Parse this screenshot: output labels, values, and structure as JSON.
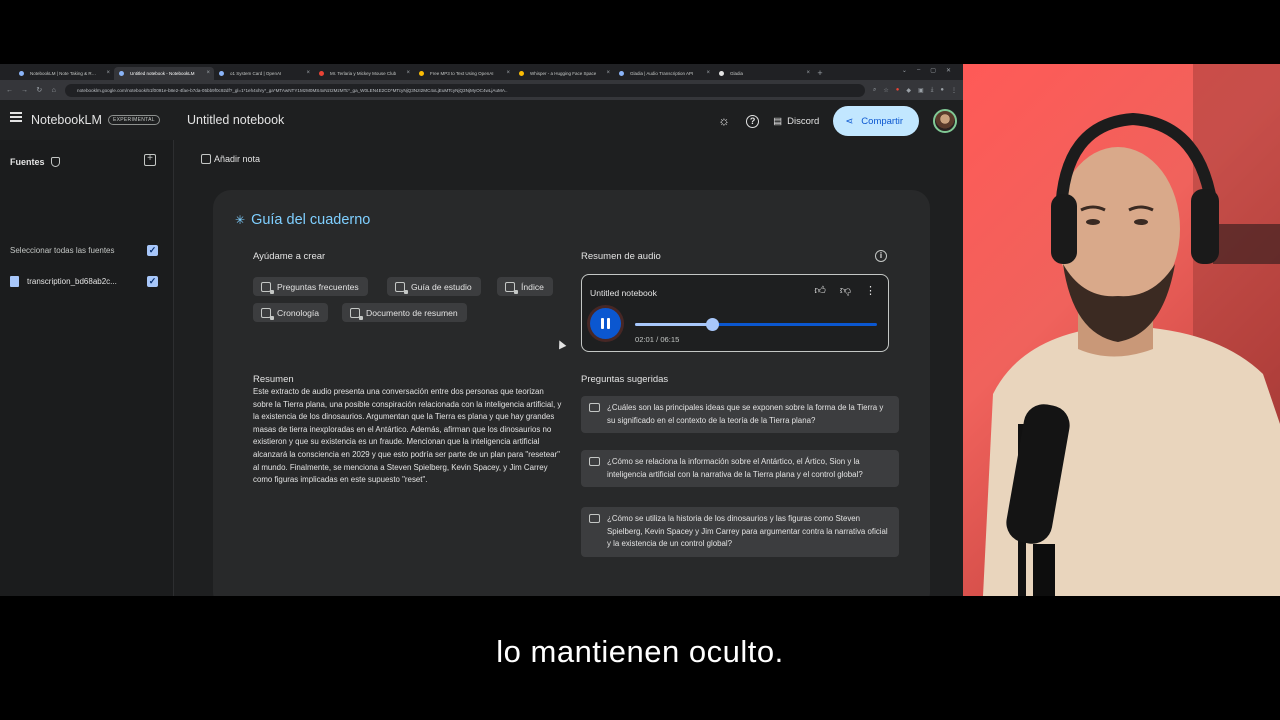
{
  "browser": {
    "tabs": [
      {
        "label": "NotebookLM | Note Taking & Research",
        "active": false
      },
      {
        "label": "Untitled notebook - NotebookLM",
        "active": true
      },
      {
        "label": "o1 System Card | OpenAI",
        "active": false
      },
      {
        "label": "Mr. Terlaria y Mickey Mouse Club",
        "active": false
      },
      {
        "label": "Free MP3 to Text Using OpenAI",
        "active": false
      },
      {
        "label": "Whisper - a Hugging Face Space",
        "active": false
      },
      {
        "label": "Gladia | Audio Transcription API",
        "active": false
      },
      {
        "label": "Gladia",
        "active": false
      }
    ],
    "new_tab": "+",
    "url": "notebooklm.google.com/notebook/51f0091e-b8e2-4fae-b7da-05bb9f0c92df?_gl=1*1eh4xhry*_ga*MTAwNTY1MzM0MS4xNzI2MzMTc*_ga_W0LEN4E2CD*MTcyNjQ3NzI2MC4xLjEuMTcyNjQ3NjMyOC4wLjAuMA.."
  },
  "app": {
    "brand": "NotebookLM",
    "badge": "EXPERIMENTAL",
    "notebook_title": "Untitled notebook",
    "discord_label": "Discord",
    "share_label": "Compartir"
  },
  "sidebar": {
    "title": "Fuentes",
    "select_all": "Seleccionar todas las fuentes",
    "sources": [
      {
        "label": "transcription_bd68ab2c..."
      }
    ]
  },
  "main": {
    "add_note": "Añadir nota",
    "guide_title": "Guía del cuaderno",
    "help_create": "Ayúdame a crear",
    "chips": [
      "Preguntas frecuentes",
      "Guía de estudio",
      "Índice",
      "Cronología",
      "Documento de resumen"
    ],
    "audio": {
      "heading": "Resumen de audio",
      "title": "Untitled notebook",
      "time": "02:01 / 06:15",
      "progress": 0.32
    },
    "summary_heading": "Resumen",
    "summary_text": "Este extracto de audio presenta una conversación entre dos personas que teorizan sobre la Tierra plana, una posible conspiración relacionada con la inteligencia artificial, y la existencia de los dinosaurios. Argumentan que la Tierra es plana y que hay grandes masas de tierra inexploradas en el Antártico. Además, afirman que los dinosaurios no existieron y que su existencia es un fraude. Mencionan que la inteligencia artificial alcanzará la consciencia en 2029 y que esto podría ser parte de un plan para \"resetear\" al mundo. Finalmente, se menciona a Steven Spielberg, Kevin Spacey, y Jim Carrey como figuras implicadas en este supuesto \"reset\".",
    "suggested_heading": "Preguntas sugeridas",
    "suggested": [
      "¿Cuáles son las principales ideas que se exponen sobre la forma de la Tierra y su significado en el contexto de la teoría de la Tierra plana?",
      "¿Cómo se relaciona la información sobre el Antártico, el Ártico, Sion y la inteligencia artificial con la narrativa de la Tierra plana y el control global?",
      "¿Cómo se utiliza la historia de los dinosaurios y las figuras como Steven Spielberg, Kevin Spacey y Jim Carrey para argumentar contra la narrativa oficial y la existencia de un control global?"
    ]
  },
  "subtitle": "lo mantienen oculto.",
  "colors": {
    "accent": "#7fcfff",
    "share_bg": "#c2e7ff",
    "play": "#0b57d0",
    "webcam_bg": "#f0625c"
  }
}
